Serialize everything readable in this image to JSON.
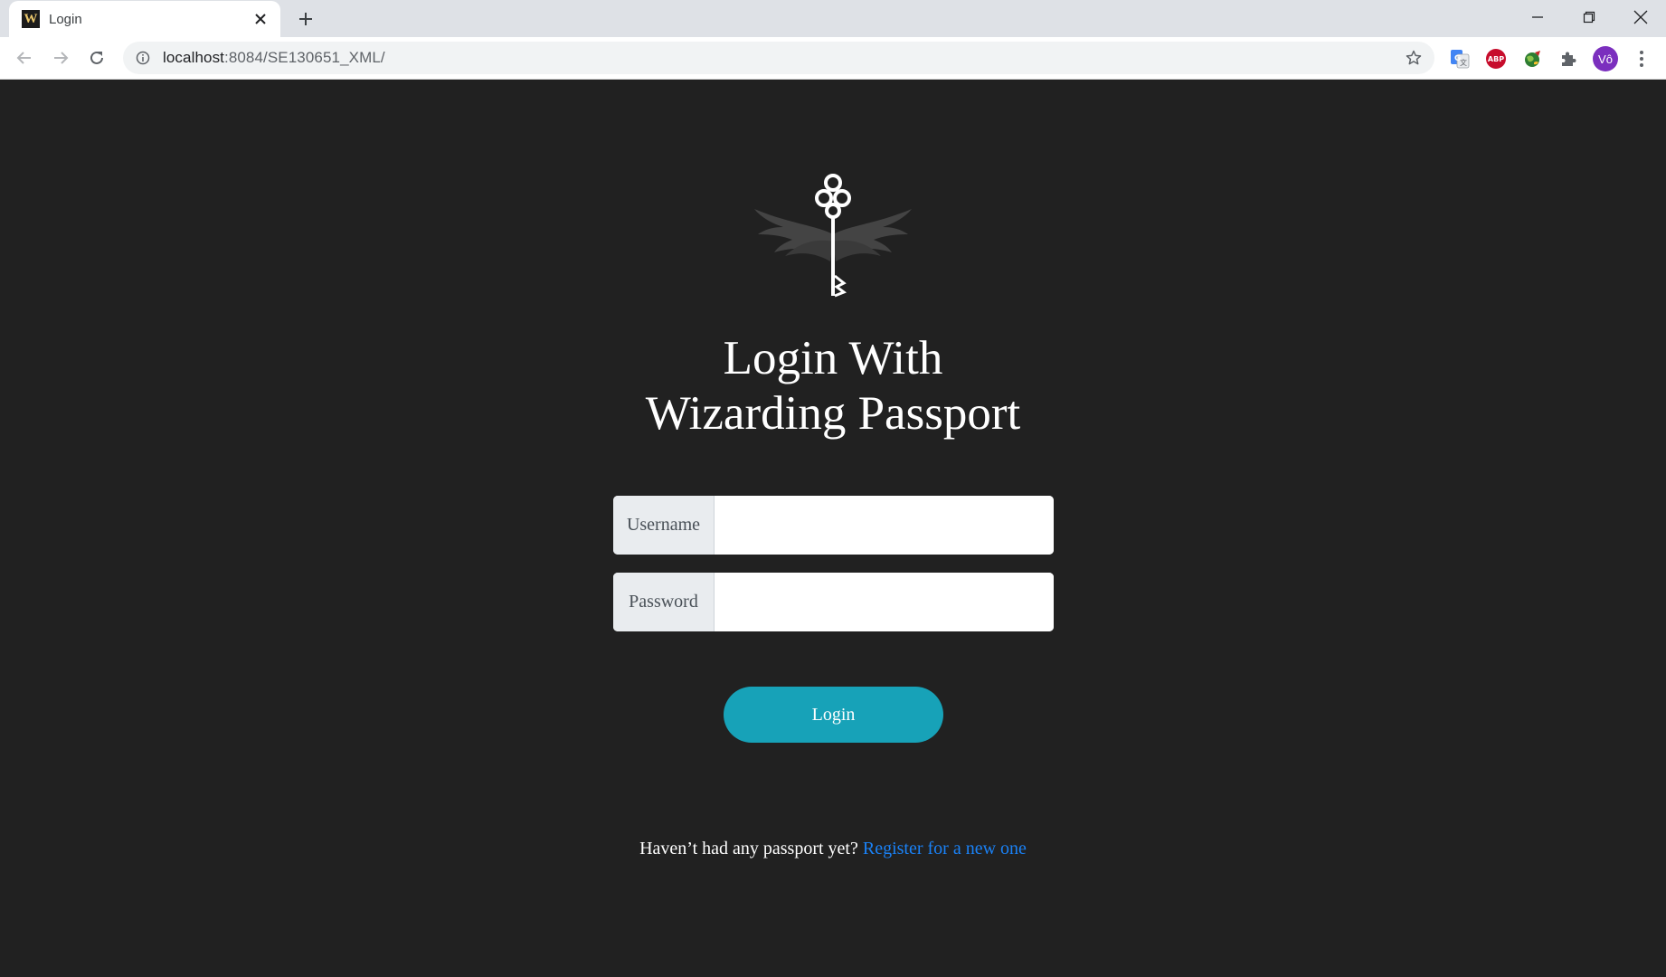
{
  "browser": {
    "tab": {
      "favicon_letter": "W",
      "title": "Login"
    },
    "url_host": "localhost",
    "url_rest": ":8084/SE130651_XML/",
    "avatar_text": "Vô",
    "abp_text": "ABP",
    "colors": {
      "tabbar": "#dee1e6",
      "toolbar": "#ffffff",
      "omnibox": "#f1f3f4",
      "avatar": "#7b2fbe",
      "abp": "#c70d2c"
    },
    "icons": [
      "back-arrow-icon",
      "forward-arrow-icon",
      "reload-icon",
      "info-icon",
      "star-icon",
      "translate-icon",
      "adblock-icon",
      "globe-extension-icon",
      "puzzle-extensions-icon",
      "kebab-menu-icon",
      "minimize-icon",
      "restore-icon",
      "close-window-icon",
      "new-tab-plus-icon",
      "tab-close-icon"
    ]
  },
  "login": {
    "heading_line1": "Login With",
    "heading_line2": "Wizarding Passport",
    "username_label": "Username",
    "username_value": "",
    "password_label": "Password",
    "password_value": "",
    "submit_label": "Login",
    "register_prompt": "Haven’t had any passport yet?",
    "register_link": "Register for a new one",
    "logo_icon": "winged-key-icon",
    "colors": {
      "background": "#212121",
      "button": "#17a2b8",
      "link": "#1a82f7",
      "label_bg": "#e9ecef"
    }
  }
}
